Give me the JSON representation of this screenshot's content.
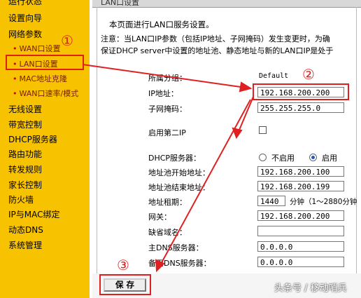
{
  "sidebar": {
    "items": [
      {
        "label": "运行状态"
      },
      {
        "label": "设置向导"
      },
      {
        "label": "网络参数"
      },
      {
        "label": "WAN口设置"
      },
      {
        "label": "LAN口设置"
      },
      {
        "label": "MAC地址克隆"
      },
      {
        "label": "WAN口速率/模式"
      },
      {
        "label": "无线设置"
      },
      {
        "label": "带宽控制"
      },
      {
        "label": "DHCP服务器"
      },
      {
        "label": "路由功能"
      },
      {
        "label": "转发规则"
      },
      {
        "label": "家长控制"
      },
      {
        "label": "防火墙"
      },
      {
        "label": "IP与MAC绑定"
      },
      {
        "label": "动态DNS"
      },
      {
        "label": "系统管理"
      }
    ]
  },
  "panel": {
    "title": "LAN口设置",
    "intro": "本页面进行LAN口服务设置。",
    "note_line1": "注意：当LAN口IP参数（包括IP地址、子网掩码）发生变更时，为确",
    "note_line2": "保证DHCP server中设置的地址池、静态地址与新的LAN口IP是处于"
  },
  "form": {
    "group_label": "所属分组：",
    "group_value": "Default",
    "ip_label": "IP地址：",
    "ip_value": "192.168.200.200",
    "mask_label": "子网掩码：",
    "mask_value": "255.255.255.0",
    "second_ip_label": "启用第二IP",
    "dhcp_label": "DHCP服务器：",
    "dhcp_off": "不启用",
    "dhcp_on": "启用",
    "pool_start_label": "地址池开始地址：",
    "pool_start_value": "192.168.200.100",
    "pool_end_label": "地址池结束地址：",
    "pool_end_value": "192.168.200.199",
    "lease_label": "地址租期：",
    "lease_value": "1440",
    "lease_unit": "分钟（1～2880分钟",
    "gateway_label": "网关：",
    "gateway_value": "192.168.200.200",
    "domain_label": "缺省域名：",
    "domain_value": "",
    "dns1_label": "主DNS服务器：",
    "dns1_value": "0.0.0.0",
    "dns2_label": "备用DNS服务器：",
    "dns2_value": "0.0.0.0"
  },
  "actions": {
    "save_label": "保 存"
  },
  "annotations": {
    "step1": "①",
    "step2": "②",
    "step3": "③",
    "color": "#e02020"
  },
  "watermark": "头条号 / 移动哨兵"
}
